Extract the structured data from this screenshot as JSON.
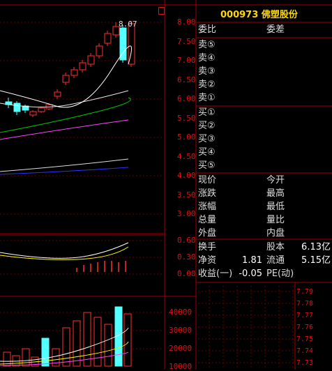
{
  "header": {
    "code": "000973",
    "name": "佛塑股份"
  },
  "chart": {
    "peak_label": "8.07"
  },
  "price_axis": [
    "8.00",
    "7.50",
    "7.00",
    "6.50",
    "6.00",
    "5.50",
    "5.00",
    "4.50",
    "4.00",
    "3.50",
    "3.00"
  ],
  "macd_axis": [
    "0.60",
    "0.30",
    "0.00"
  ],
  "volume_axis": [
    "40000",
    "30000",
    "20000",
    "10000"
  ],
  "mini_axis": [
    "7.79",
    "7.78",
    "7.77",
    "7.76",
    "7.75",
    "7.74",
    "7.73"
  ],
  "orderbook": {
    "weibi": "委比",
    "weicha": "委差",
    "sell": [
      "卖⑤",
      "卖④",
      "卖③",
      "卖②",
      "卖①"
    ],
    "buy": [
      "买①",
      "买②",
      "买③",
      "买④",
      "买⑤"
    ]
  },
  "quote": {
    "xianjia": "现价",
    "jinkai": "今开",
    "zhangdie": "涨跌",
    "zuigao": "最高",
    "zhangfu": "涨幅",
    "zuidi": "最低",
    "zongliang": "总量",
    "liangbi": "量比",
    "waipan": "外盘",
    "neipan": "内盘"
  },
  "stats": {
    "huanshou": "换手",
    "guben": "股本",
    "guben_val": "6.13亿",
    "jingzi": "净资",
    "jingzi_val": "1.81",
    "liutong": "流通",
    "liutong_val": "5.15亿",
    "shouyi": "收益(一)",
    "shouyi_val": "-0.05",
    "pe": "PE(动)"
  },
  "colors": {
    "up": "#ff3030",
    "down": "#54ffff",
    "ma1": "#ffffff",
    "ma2": "#ffff00",
    "ma3": "#00c000",
    "ma4": "#ff44ff",
    "ma5": "#3030ff",
    "grid": "#a00000"
  }
}
